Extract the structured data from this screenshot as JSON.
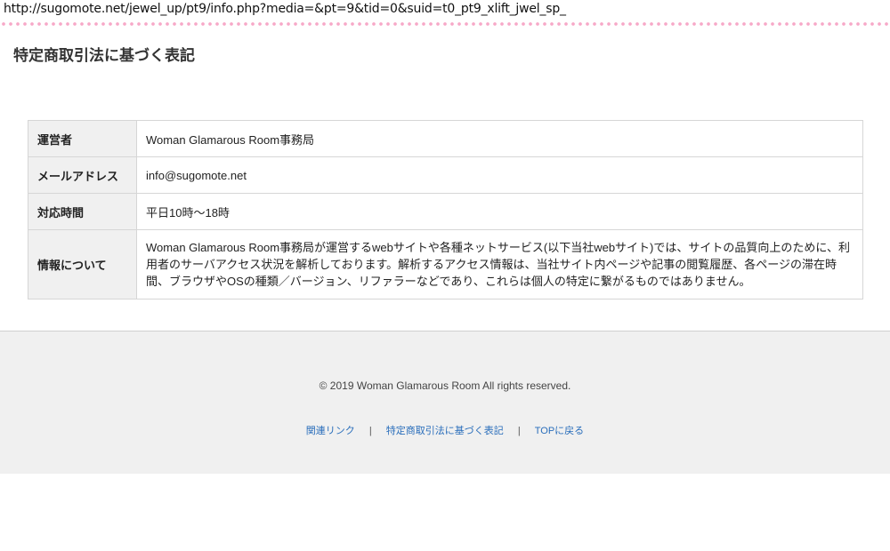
{
  "browser": {
    "url": "http://sugomote.net/jewel_up/pt9/info.php?media=&pt=9&tid=0&suid=t0_pt9_xlift_jwel_sp_"
  },
  "page": {
    "title": "特定商取引法に基づく表記"
  },
  "info_table": {
    "rows": [
      {
        "label": "運営者",
        "value": "Woman Glamarous Room事務局"
      },
      {
        "label": "メールアドレス",
        "value": "info@sugomote.net"
      },
      {
        "label": "対応時間",
        "value": "平日10時～18時"
      },
      {
        "label": "情報について",
        "value": "Woman Glamarous Room事務局が運営するwebサイトや各種ネットサービス(以下当社webサイト)では、サイトの品質向上のために、利用者のサーバアクセス状況を解析しております。解析するアクセス情報は、当社サイト内ページや記事の閲覧履歴、各ページの滞在時間、ブラウザやOSの種類／バージョン、リファラーなどであり、これらは個人の特定に繋がるものではありません。"
      }
    ]
  },
  "footer": {
    "copyright": "© 2019 Woman Glamarous Room All rights reserved.",
    "links": [
      {
        "label": "関連リンク"
      },
      {
        "label": "特定商取引法に基づく表記"
      },
      {
        "label": "TOPに戻る"
      }
    ],
    "separator": "|"
  },
  "colors": {
    "dot_accent": "#f7a8c8",
    "link": "#2a6ebb",
    "footer_bg": "#f0f0f0",
    "header_cell_bg": "#f0f0f0"
  }
}
